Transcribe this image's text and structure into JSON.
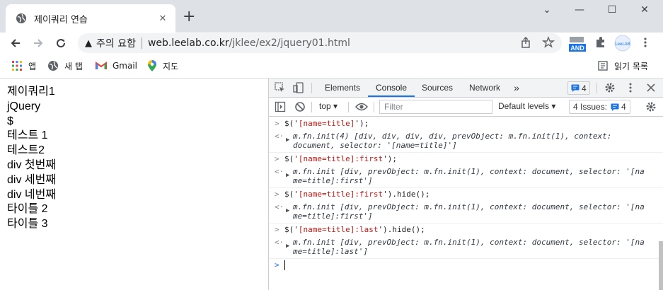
{
  "browser": {
    "tab_title": "제이쿼리 연습",
    "tab_close": "✕",
    "new_tab": "+",
    "window_controls": {
      "minimize": "⌄",
      "min2": "—",
      "max": "☐",
      "close": "✕"
    },
    "security_text": "주의 요함",
    "url_host": "web.leelab.co.kr",
    "url_path": "/jklee/ex2/jquery01.html",
    "extension_badge": "AND",
    "profile_label": "LeeLAB"
  },
  "bookmarks": [
    {
      "label": "앱",
      "icon": "apps-grid-icon"
    },
    {
      "label": "새 탭",
      "icon": "globe-icon"
    },
    {
      "label": "Gmail",
      "icon": "gmail-icon"
    },
    {
      "label": "지도",
      "icon": "maps-pin-icon"
    }
  ],
  "reading_list": "읽기 목록",
  "page": {
    "lines": [
      "제이쿼리1",
      "jQuery",
      "$",
      "테스트 1",
      "테스트2",
      "div 첫번째",
      "div 세번째",
      "div 네번째",
      "타이틀 2",
      "타이틀 3"
    ]
  },
  "devtools": {
    "tabs": [
      "Elements",
      "Console",
      "Sources",
      "Network"
    ],
    "active_tab": "Console",
    "more_tabs": "»",
    "issue_badge_count": "4",
    "context": "top",
    "filter_placeholder": "Filter",
    "levels": "Default levels",
    "issues_label": "4 Issues:",
    "issues_count": "4"
  },
  "console": [
    {
      "cmd_pre": "$('",
      "cmd_str": "[name=title]",
      "cmd_post": "');",
      "res_line1": "m.fn.init(4) [div, div, div, div, prevObject: m.fn.init(1), context:",
      "res_line2": "document, selector: '[name=title]']"
    },
    {
      "cmd_pre": "$('",
      "cmd_str": "[name=title]:first",
      "cmd_post": "');",
      "res_line1": "m.fn.init [div, prevObject: m.fn.init(1), context: document, selector: '[na",
      "res_line2": "me=title]:first']"
    },
    {
      "cmd_pre": "$('",
      "cmd_str": "[name=title]:first",
      "cmd_post": "').hide();",
      "res_line1": "m.fn.init [div, prevObject: m.fn.init(1), context: document, selector: '[na",
      "res_line2": "me=title]:first']"
    },
    {
      "cmd_pre": "$('",
      "cmd_str": "[name=title]:last",
      "cmd_post": "').hide();",
      "res_line1": "m.fn.init [div, prevObject: m.fn.init(1), context: document, selector: '[na",
      "res_line2": "me=title]:last']"
    }
  ]
}
